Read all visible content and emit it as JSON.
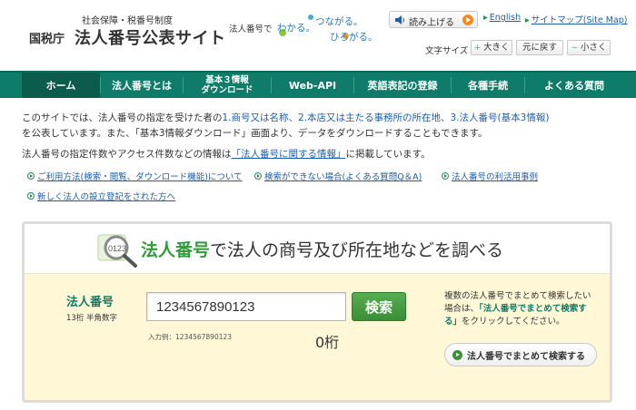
{
  "header": {
    "subtitle": "社会保障・税番号制度",
    "agency": "国税庁",
    "site_title": "法人番号公表サイト",
    "tagline": "法人番号で",
    "slogan": [
      "わかる。",
      "つながる。",
      "ひろがる。"
    ],
    "read_aloud": "読み上げる",
    "english": "English",
    "sitemap": "サイトマップ(Site Map)",
    "font_size_label": "文字サイズ",
    "font_buttons": [
      "大きく",
      "元に戻す",
      "小さく"
    ]
  },
  "nav": [
    {
      "label": "ホーム",
      "active": true
    },
    {
      "label": "法人番号とは"
    },
    {
      "label": [
        "基本３情報",
        "ダウンロード"
      ]
    },
    {
      "label": "Web-API"
    },
    {
      "label": "英語表記の登録"
    },
    {
      "label": "各種手続"
    },
    {
      "label": "よくある質問"
    }
  ],
  "intro": {
    "line1_a": "このサイトでは、法人番号の指定を受けた者の",
    "line1_b": "1.商号又は名称、2.本店又は主たる事務所の所在地、3.法人番号(基本3情報)",
    "line2": "を公表しています。また、「基本3情報ダウンロード」画面より、データをダウンロードすることもできます。",
    "line3_a": "法人番号の指定件数やアクセス件数などの情報は",
    "line3_link": "「法人番号に関する情報」",
    "line3_b": "に掲載しています。"
  },
  "quick_links": [
    "ご利用方法(検索・閲覧、ダウンロード機能)について",
    "検索ができない場合(よくある質問Q＆A)",
    "法人番号の利活用事例",
    "新しく法人の設立登記をされた方へ"
  ],
  "search": {
    "title_highlight": "法人番号",
    "title_rest": "で法人の商号及び所在地などを調べる",
    "magnifier_digits": "0123",
    "field_label": "法人番号",
    "field_hint": "13桁 半角数字",
    "input_value": "1234567890123",
    "search_button": "検索",
    "example": "入力例：1234567890123",
    "digit_count": "0桁",
    "multi_text_a": "複数の法人番号でまとめて検索したい場合は、",
    "multi_text_quote": "「法人番号でまとめて検索する」",
    "multi_text_b": "をクリックしてください。",
    "multi_button": "法人番号でまとめて検索する"
  },
  "colors": {
    "nav": "#0e7c68",
    "accent_green": "#2e9c3a",
    "link": "#1a5fb4",
    "panel_bg": "#fff7d6"
  }
}
